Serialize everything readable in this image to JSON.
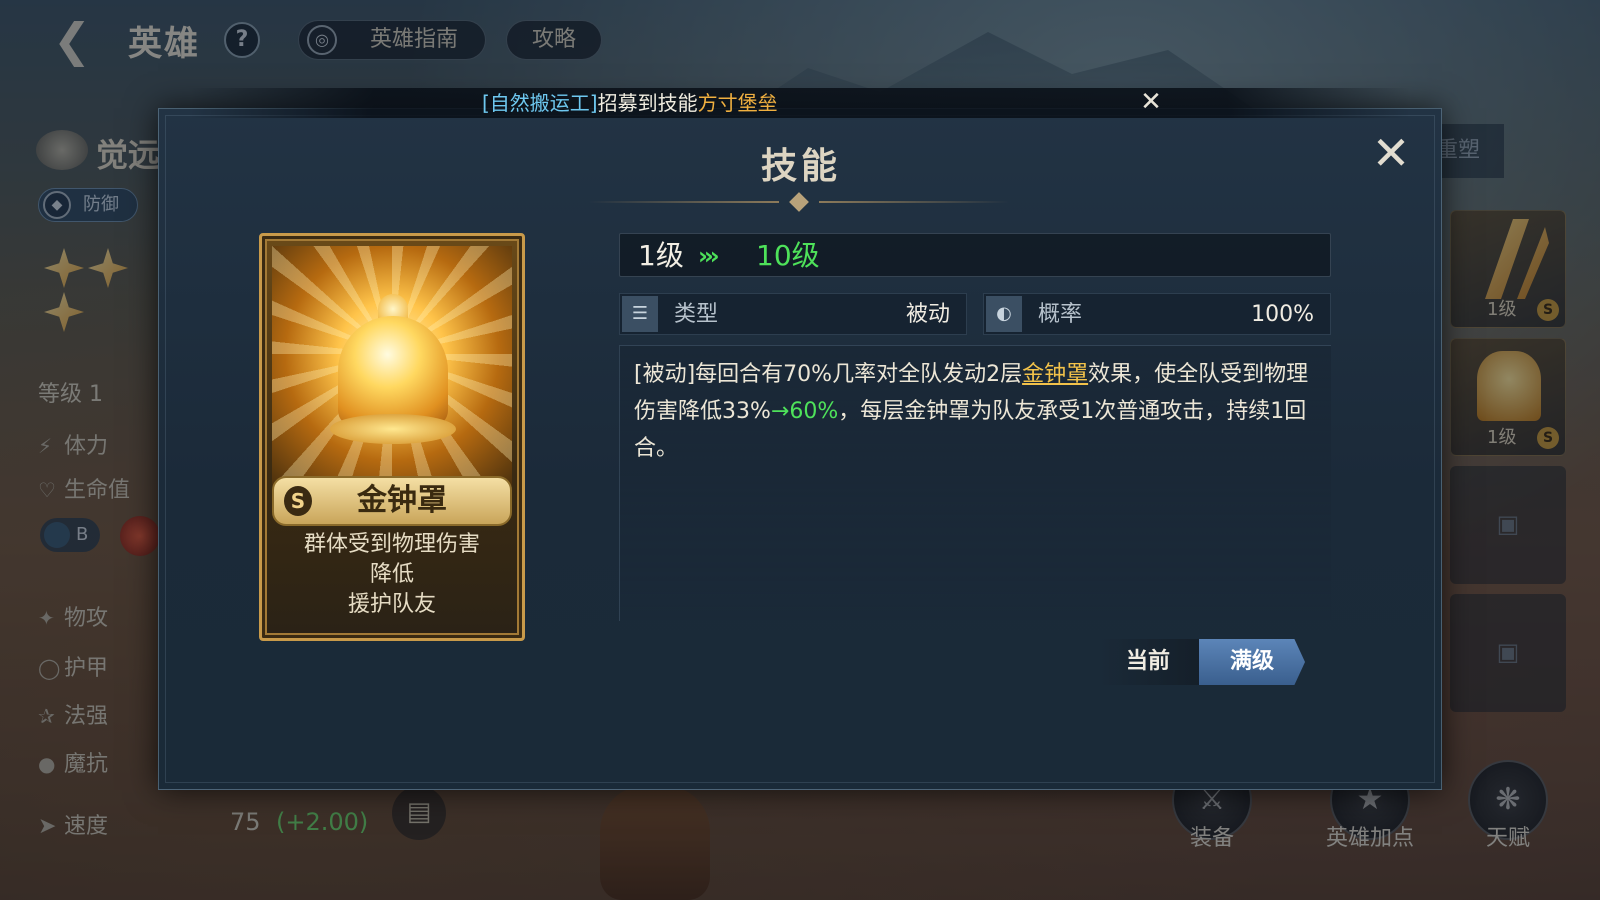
{
  "topbar": {
    "title": "英雄",
    "help": "?",
    "guide_label": "英雄指南",
    "strategy_label": "攻略"
  },
  "left_panel": {
    "awaken_label": "觉远",
    "defense_tag": "防御",
    "level_label": "等级",
    "level_value": "1",
    "stats": [
      "体力",
      "生命值",
      "物攻",
      "护甲",
      "法强",
      "魔抗",
      "速度"
    ],
    "badge_b": "B",
    "speed_value": "75",
    "speed_bonus": "(+2.00)",
    "stars": 3
  },
  "notice": {
    "user": "[自然搬运工]",
    "middle": "招募到技能",
    "skill": "方寸堡垒"
  },
  "dialog": {
    "title": "技能",
    "card": {
      "rank": "S",
      "name": "金钟罩",
      "desc_lines": [
        "群体受到物理伤害",
        "降低",
        "援护队友"
      ]
    },
    "level_from": "1级",
    "level_arrow": "›››",
    "level_to": "10级",
    "type_label": "类型",
    "type_value": "被动",
    "rate_label": "概率",
    "rate_value": "100%",
    "desc": {
      "part1": "[被动]每回合有70%几率对全队发动2层",
      "keyword": "金钟罩",
      "part2": "效果，使全队受到物理伤害降低33%",
      "upgrade": "→60%",
      "part3": "，每层金钟罩为队友承受1次普通攻击，持续1回合。"
    },
    "btn_current": "当前",
    "btn_max": "满级"
  },
  "right_panel": {
    "reshape_label": "重塑",
    "slot_level": "1级",
    "slot_rank": "S"
  },
  "bottom": {
    "equip": "装备",
    "points": "英雄加点",
    "talent": "天赋"
  },
  "colors": {
    "highlight_green": "#4ee25a",
    "keyword_gold": "#f2c24a",
    "notice_user_blue": "#6ec8f0",
    "notice_skill_orange": "#f0b040",
    "max_button_blue": "#4a72a4"
  }
}
